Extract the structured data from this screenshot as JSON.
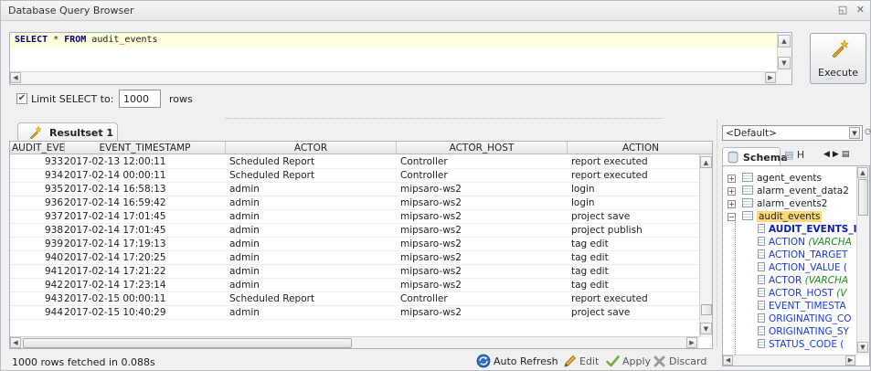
{
  "window": {
    "title": "Database Query Browser",
    "controls": [
      "◱",
      "✕"
    ]
  },
  "query": {
    "keyword1": "SELECT",
    "star": " * ",
    "keyword2": "FROM",
    "table": " audit_events"
  },
  "execute": {
    "label": "Execute"
  },
  "limit": {
    "label": "Limit SELECT to:",
    "value": "1000",
    "suffix": "rows",
    "checked": true
  },
  "results": {
    "tab_label": "Resultset 1",
    "columns": [
      "AUDIT_EVENTS...",
      "EVENT_TIMESTAMP",
      "ACTOR",
      "ACTOR_HOST",
      "ACTION"
    ],
    "rows": [
      [
        "933",
        "2017-02-13 12:00:11",
        "Scheduled Report",
        "Controller",
        "report executed"
      ],
      [
        "934",
        "2017-02-14 00:00:11",
        "Scheduled Report",
        "Controller",
        "report executed"
      ],
      [
        "935",
        "2017-02-14 16:58:13",
        "admin",
        "mipsaro-ws2",
        "login"
      ],
      [
        "936",
        "2017-02-14 16:59:42",
        "admin",
        "mipsaro-ws2",
        "login"
      ],
      [
        "937",
        "2017-02-14 17:01:45",
        "admin",
        "mipsaro-ws2",
        "project save"
      ],
      [
        "938",
        "2017-02-14 17:01:45",
        "admin",
        "mipsaro-ws2",
        "project publish"
      ],
      [
        "939",
        "2017-02-14 17:19:13",
        "admin",
        "mipsaro-ws2",
        "tag edit"
      ],
      [
        "940",
        "2017-02-14 17:20:25",
        "admin",
        "mipsaro-ws2",
        "tag edit"
      ],
      [
        "941",
        "2017-02-14 17:21:22",
        "admin",
        "mipsaro-ws2",
        "tag edit"
      ],
      [
        "942",
        "2017-02-14 17:23:14",
        "admin",
        "mipsaro-ws2",
        "tag edit"
      ],
      [
        "943",
        "2017-02-15 00:00:11",
        "Scheduled Report",
        "Controller",
        "report executed"
      ],
      [
        "944",
        "2017-02-15 10:40:29",
        "admin",
        "mipsaro-ws2",
        "project save"
      ]
    ]
  },
  "status": {
    "text": "1000 rows fetched in 0.088s",
    "auto_refresh": "Auto Refresh",
    "edit": "Edit",
    "apply": "Apply",
    "discard": "Discard"
  },
  "datasource": {
    "selected": "<Default>"
  },
  "schema": {
    "tab_label": "Schema",
    "history_tab": "H",
    "tables": [
      {
        "name": "agent_events",
        "expanded": false
      },
      {
        "name": "alarm_event_data2",
        "expanded": false
      },
      {
        "name": "alarm_events2",
        "expanded": false
      },
      {
        "name": "audit_events",
        "expanded": true
      }
    ],
    "columns": [
      {
        "name": "AUDIT_EVENTS_I",
        "type": "",
        "pk": true
      },
      {
        "name": "ACTION ",
        "type": "(VARCHA",
        "pk": false
      },
      {
        "name": "ACTION_TARGET",
        "type": "",
        "pk": false
      },
      {
        "name": "ACTION_VALUE (",
        "type": "",
        "pk": false
      },
      {
        "name": "ACTOR ",
        "type": "(VARCHA",
        "pk": false
      },
      {
        "name": "ACTOR_HOST ",
        "type": "(V",
        "pk": false
      },
      {
        "name": "EVENT_TIMESTA",
        "type": "",
        "pk": false
      },
      {
        "name": "ORIGINATING_CO",
        "type": "",
        "pk": false
      },
      {
        "name": "ORIGINATING_SY",
        "type": "",
        "pk": false
      },
      {
        "name": "STATUS_CODE (",
        "type": "",
        "pk": false
      }
    ]
  },
  "colors": {
    "query_highlight": "#ffffdc",
    "selected_node": "#f7d87a",
    "column_text": "#1a3ad6",
    "type_text": "#1e8c1e"
  },
  "icons": [
    "restore-icon",
    "close-icon",
    "execute-wand-icon",
    "resultset-icon",
    "auto-refresh-icon",
    "edit-pencil-icon",
    "apply-check-icon",
    "discard-x-icon",
    "schema-db-icon",
    "history-icon",
    "table-icon",
    "column-icon"
  ]
}
